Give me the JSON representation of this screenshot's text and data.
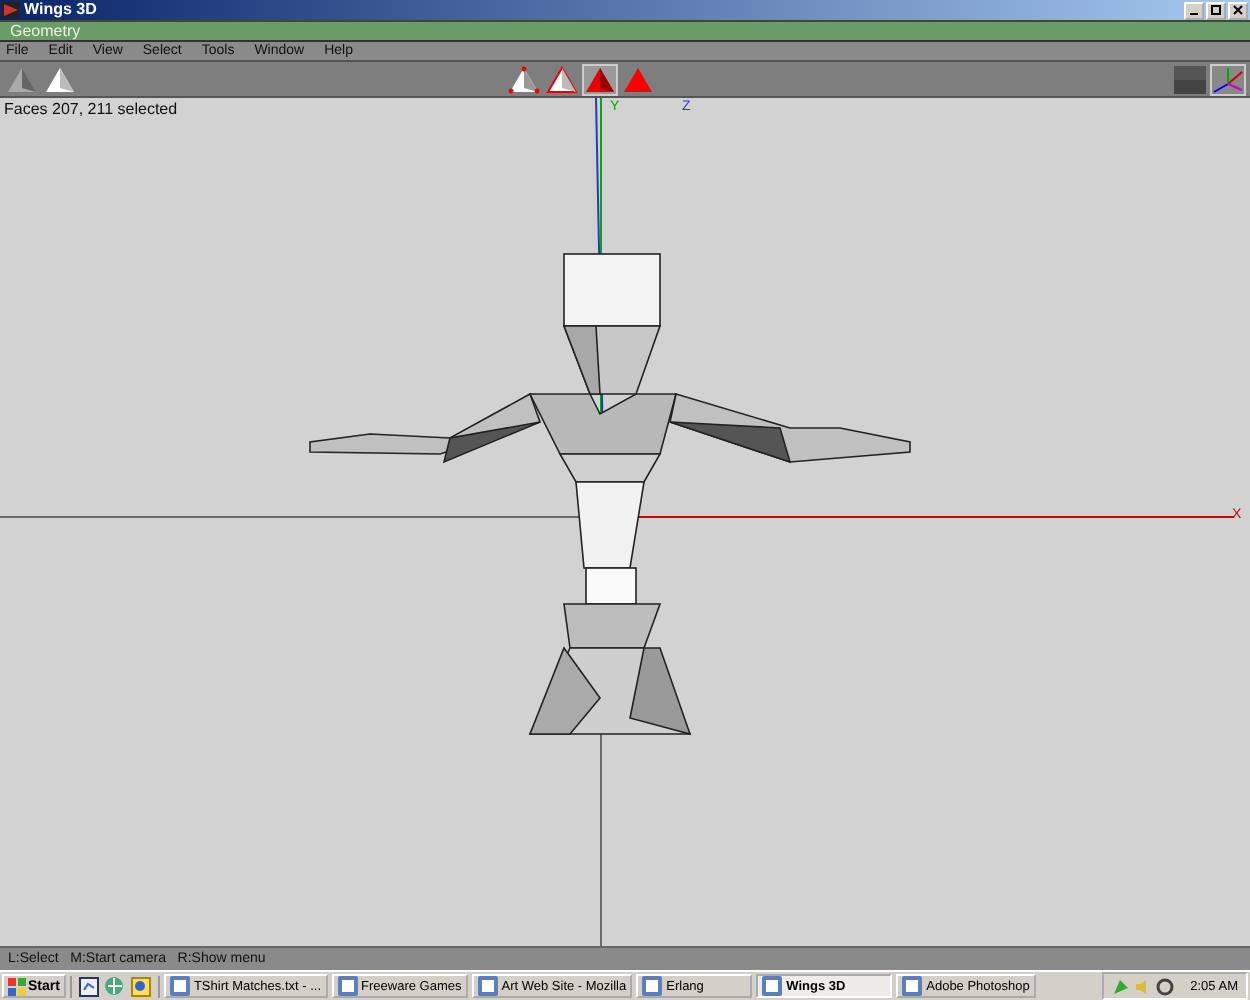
{
  "window": {
    "title": "Wings 3D"
  },
  "panel": {
    "title": "Geometry"
  },
  "menu": [
    "File",
    "Edit",
    "View",
    "Select",
    "Tools",
    "Window",
    "Help"
  ],
  "select_modes": [
    {
      "kind": "vertex",
      "selected": false
    },
    {
      "kind": "edge",
      "selected": false
    },
    {
      "kind": "face",
      "selected": true
    },
    {
      "kind": "body",
      "selected": false
    }
  ],
  "viewport": {
    "info": "Faces 207, 211 selected",
    "axis_labels": [
      {
        "kind": "y",
        "text": "Y"
      },
      {
        "kind": "z",
        "text": "Z"
      },
      {
        "kind": "x",
        "text": "X"
      }
    ]
  },
  "status_bar": "L:Select   M:Start camera   R:Show menu",
  "taskbar": {
    "start": "Start",
    "tasks": [
      {
        "label": "TShirt Matches.txt - ...",
        "selected": false
      },
      {
        "label": "Freeware Games",
        "selected": false
      },
      {
        "label": "Art Web Site - Mozilla",
        "selected": false
      },
      {
        "label": "Erlang",
        "selected": false
      },
      {
        "label": "Wings 3D",
        "selected": true
      },
      {
        "label": "Adobe Photoshop",
        "selected": false
      }
    ],
    "clock": "2:05 AM"
  }
}
